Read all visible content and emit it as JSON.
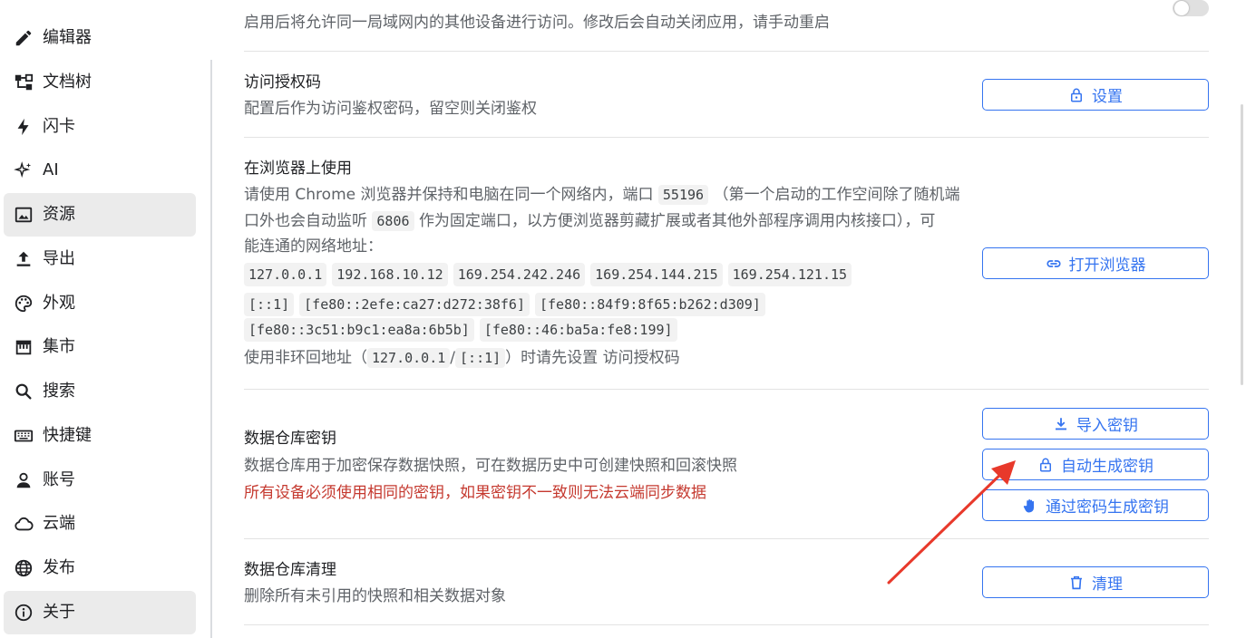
{
  "sidebar": {
    "items": [
      {
        "label": "编辑器",
        "icon": "pencil-icon"
      },
      {
        "label": "文档树",
        "icon": "tree-icon"
      },
      {
        "label": "闪卡",
        "icon": "bolt-icon"
      },
      {
        "label": "AI",
        "icon": "sparkle-icon"
      },
      {
        "label": "资源",
        "icon": "image-icon"
      },
      {
        "label": "导出",
        "icon": "upload-icon"
      },
      {
        "label": "外观",
        "icon": "palette-icon"
      },
      {
        "label": "集市",
        "icon": "store-icon"
      },
      {
        "label": "搜索",
        "icon": "search-icon"
      },
      {
        "label": "快捷键",
        "icon": "keyboard-icon"
      },
      {
        "label": "账号",
        "icon": "user-icon"
      },
      {
        "label": "云端",
        "icon": "cloud-icon"
      },
      {
        "label": "发布",
        "icon": "globe-icon"
      },
      {
        "label": "关于",
        "icon": "info-icon"
      }
    ],
    "active_index": [
      4,
      13
    ]
  },
  "sections": {
    "lan": {
      "desc": "启用后将允许同一局域网内的其他设备进行访问。修改后会自动关闭应用，请手动重启",
      "toggle_on": false
    },
    "auth": {
      "title": "访问授权码",
      "desc": "配置后作为访问鉴权密码，留空则关闭鉴权",
      "button": "设置"
    },
    "browser": {
      "title": "在浏览器上使用",
      "desc_1a": "请使用 Chrome 浏览器并保持和电脑在同一个网络内，端口",
      "port": "55196",
      "desc_1b": "（第一个启动的工作空间除了随机端",
      "desc_2a": "口外也会自动监听",
      "fixed_port": "6806",
      "desc_2b": "作为固定端口，以方便浏览器剪藏扩展或者其他外部程序调用内核接口），可",
      "desc_3": "能连通的网络地址：",
      "addresses_1": [
        "127.0.0.1",
        "192.168.10.12",
        "169.254.242.246",
        "169.254.144.215",
        "169.254.121.15"
      ],
      "addresses_2": [
        "[::1]",
        "[fe80::2efe:ca27:d272:38f6]",
        "[fe80::84f9:8f65:b262:d309]"
      ],
      "addresses_3": [
        "[fe80::3c51:b9c1:ea8a:6b5b]",
        "[fe80::46:ba5a:fe8:199]"
      ],
      "note_a": "使用非环回地址（",
      "note_loop_1": "127.0.0.1",
      "note_sep": "/",
      "note_loop_2": "[::1]",
      "note_b": "）时请先设置 访问授权码",
      "button": "打开浏览器"
    },
    "repo_key": {
      "title": "数据仓库密钥",
      "desc": "数据仓库用于加密保存数据快照，可在数据历史中可创建快照和回滚快照",
      "warning": "所有设备必须使用相同的密钥，如果密钥不一致则无法云端同步数据",
      "btn_import": "导入密钥",
      "btn_auto": "自动生成密钥",
      "btn_password": "通过密码生成密钥"
    },
    "repo_clean": {
      "title": "数据仓库清理",
      "desc": "删除所有未引用的快照和相关数据对象",
      "button": "清理"
    }
  },
  "colors": {
    "accent": "#3574f0",
    "warning": "#c5392f",
    "annotation_arrow": "#e8392b"
  }
}
